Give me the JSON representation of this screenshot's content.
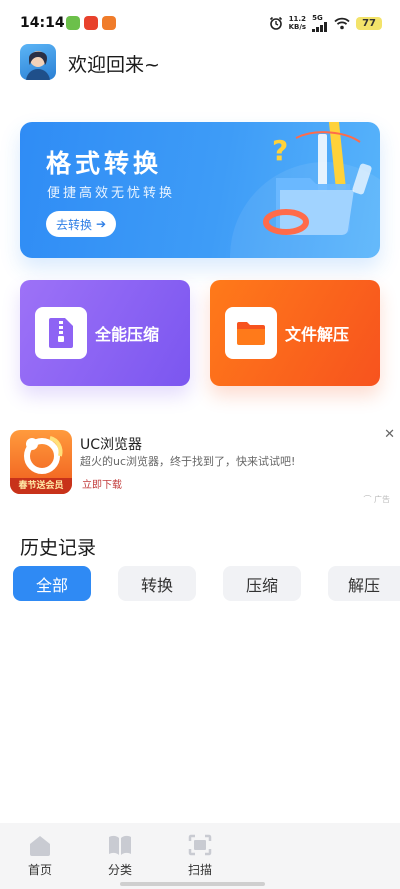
{
  "status_bar": {
    "time": "14:14",
    "speed_value": "11.2",
    "speed_unit": "KB/s",
    "network": "5G",
    "battery": "77",
    "colors": {
      "app1": "#f0582e",
      "app2": "#e8412c",
      "app3": "#f07c2a"
    }
  },
  "header": {
    "greeting": "欢迎回来~"
  },
  "banner": {
    "title": "格式转换",
    "subtitle": "便捷高效无忧转换",
    "button_label": "去转换",
    "button_icon": "arrow-right-icon"
  },
  "features": [
    {
      "label": "全能压缩",
      "icon": "zip-file-icon",
      "color": "#7b56f0"
    },
    {
      "label": "文件解压",
      "icon": "folder-icon",
      "color": "#f7531e"
    }
  ],
  "ad": {
    "title": "UC浏览器",
    "description": "超火的uc浏览器，终于找到了，快来试试吧!",
    "cta": "立即下载",
    "logo_band": "春节送会员",
    "tag": "广告",
    "close_icon": "close-icon"
  },
  "history": {
    "title": "历史记录",
    "filters": [
      "全部",
      "转换",
      "压缩",
      "解压"
    ],
    "active_filter": "全部"
  },
  "bottom_nav": {
    "items": [
      {
        "label": "首页",
        "icon": "home-icon"
      },
      {
        "label": "分类",
        "icon": "book-icon"
      },
      {
        "label": "扫描",
        "icon": "scan-icon"
      }
    ]
  },
  "colors": {
    "accent": "#2f8af4"
  }
}
